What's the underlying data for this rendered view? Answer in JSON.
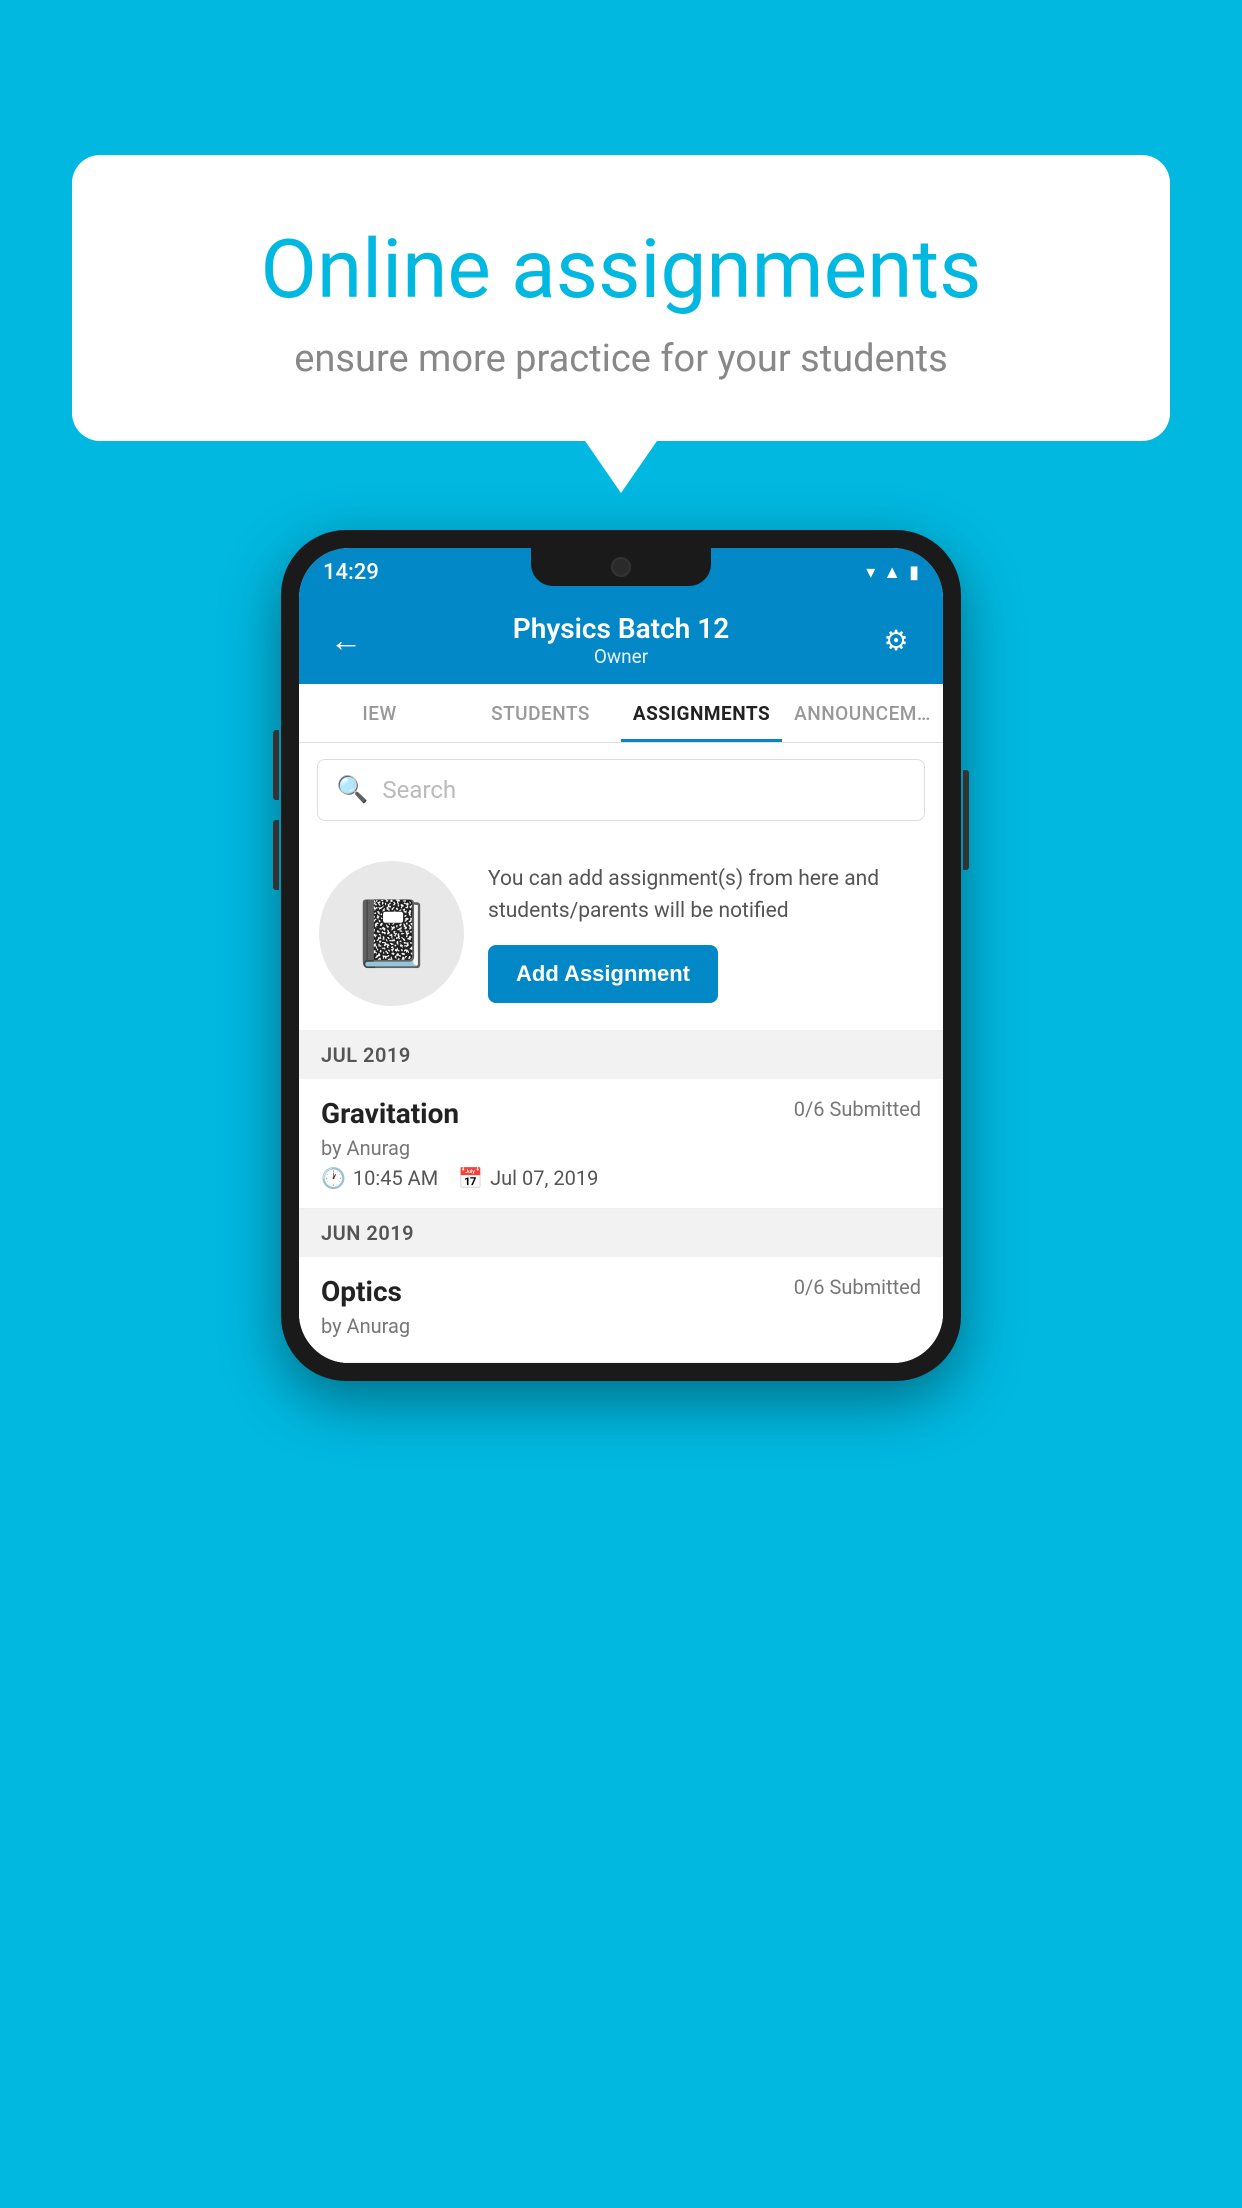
{
  "background_color": "#00B8E0",
  "bubble": {
    "title": "Online assignments",
    "subtitle": "ensure more practice for your students"
  },
  "status_bar": {
    "time": "14:29",
    "icons": [
      "wifi",
      "signal",
      "battery"
    ]
  },
  "header": {
    "title": "Physics Batch 12",
    "subtitle": "Owner",
    "back_label": "←",
    "settings_label": "⚙"
  },
  "tabs": [
    {
      "label": "IEW",
      "active": false
    },
    {
      "label": "STUDENTS",
      "active": false
    },
    {
      "label": "ASSIGNMENTS",
      "active": true
    },
    {
      "label": "ANNOUNCEM…",
      "active": false
    }
  ],
  "search": {
    "placeholder": "Search"
  },
  "promo": {
    "text": "You can add assignment(s) from here and students/parents will be notified",
    "button_label": "Add Assignment"
  },
  "sections": [
    {
      "label": "JUL 2019",
      "assignments": [
        {
          "name": "Gravitation",
          "submitted": "0/6 Submitted",
          "by": "by Anurag",
          "time": "10:45 AM",
          "date": "Jul 07, 2019"
        }
      ]
    },
    {
      "label": "JUN 2019",
      "assignments": [
        {
          "name": "Optics",
          "submitted": "0/6 Submitted",
          "by": "by Anurag",
          "time": "",
          "date": ""
        }
      ]
    }
  ]
}
